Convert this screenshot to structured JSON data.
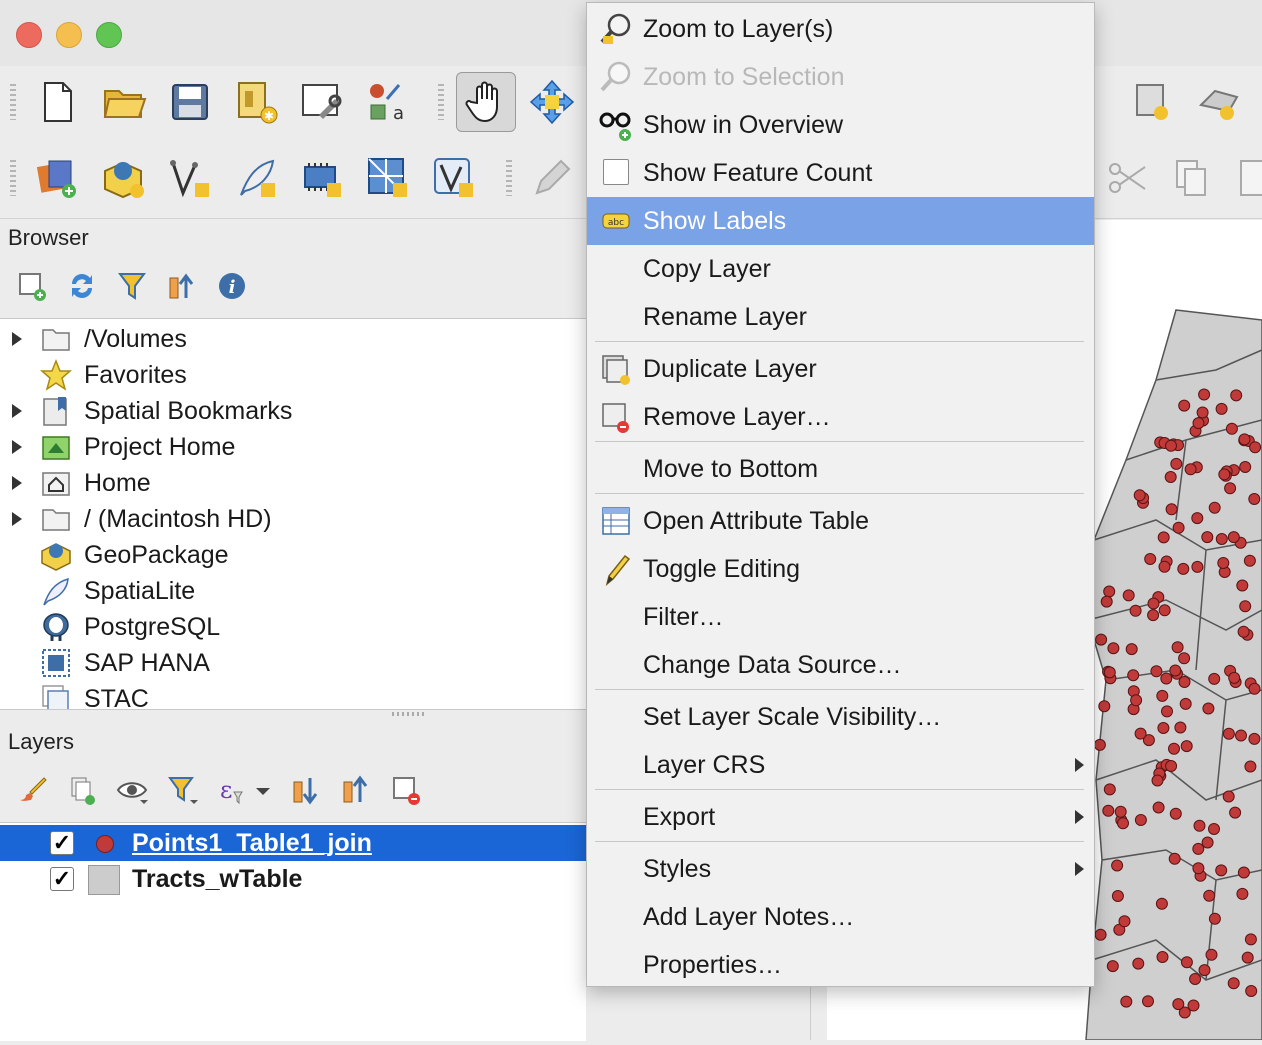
{
  "window": {
    "close_color": "#ed6a5e",
    "minimize_color": "#f5bf4f",
    "zoom_color": "#61c554"
  },
  "browser": {
    "title": "Browser",
    "tools": [
      "add-layer-icon",
      "refresh-icon",
      "filter-icon",
      "collapse-all-icon",
      "info-icon"
    ],
    "items": [
      {
        "label": "/Volumes",
        "icon": "folder-icon",
        "expandable": true
      },
      {
        "label": "Favorites",
        "icon": "star-icon",
        "expandable": false
      },
      {
        "label": "Spatial Bookmarks",
        "icon": "bookmark-icon",
        "expandable": true
      },
      {
        "label": "Project Home",
        "icon": "project-home-icon",
        "expandable": true
      },
      {
        "label": "Home",
        "icon": "home-icon",
        "expandable": true
      },
      {
        "label": "/ (Macintosh HD)",
        "icon": "folder-icon",
        "expandable": true
      },
      {
        "label": "GeoPackage",
        "icon": "geopackage-icon",
        "expandable": false
      },
      {
        "label": "SpatiaLite",
        "icon": "spatialite-icon",
        "expandable": false
      },
      {
        "label": "PostgreSQL",
        "icon": "postgresql-icon",
        "expandable": false
      },
      {
        "label": "SAP HANA",
        "icon": "sap-hana-icon",
        "expandable": false
      },
      {
        "label": "STAC",
        "icon": "stac-icon",
        "expandable": false
      }
    ]
  },
  "layers": {
    "title": "Layers",
    "items": [
      {
        "label": "Points1_Table1_join",
        "checked": true,
        "selected": true,
        "symbol_color": "#c03a3a"
      },
      {
        "label": "Tracts_wTable",
        "checked": true,
        "selected": false,
        "symbol_color": "#cccccc"
      }
    ],
    "checkmark": "✓"
  },
  "context_menu": {
    "items": [
      {
        "label": "Zoom to Layer(s)",
        "mnemonic": "Z",
        "icon": "zoom-layer-icon",
        "enabled": true
      },
      {
        "label": "Zoom to Selection",
        "mnemonic": "S",
        "icon": "zoom-selection-icon",
        "enabled": false
      },
      {
        "label": "Show in Overview",
        "mnemonic": "O",
        "icon": "overview-glasses-icon",
        "enabled": true
      },
      {
        "label": "Show Feature Count",
        "mnemonic": "C",
        "icon": "checkbox-icon",
        "enabled": true
      },
      {
        "label": "Show Labels",
        "mnemonic": "L",
        "icon": "labels-abc-icon",
        "enabled": true,
        "highlighted": true
      },
      {
        "label": "Copy Layer",
        "enabled": true
      },
      {
        "label": "Rename Layer",
        "mnemonic": "n",
        "enabled": true
      },
      {
        "label": "Duplicate Layer",
        "mnemonic": "D",
        "icon": "duplicate-layer-icon",
        "enabled": true
      },
      {
        "label": "Remove Layer…",
        "mnemonic": "R",
        "icon": "remove-layer-icon",
        "enabled": true
      },
      {
        "label": "Move to Bottom",
        "mnemonic": "B",
        "enabled": true
      },
      {
        "label": "Open Attribute Table",
        "mnemonic": "A",
        "icon": "attribute-table-icon",
        "enabled": true
      },
      {
        "label": "Toggle Editing",
        "mnemonic": "E",
        "icon": "pencil-icon",
        "enabled": true
      },
      {
        "label": "Filter…",
        "mnemonic": "F",
        "enabled": true
      },
      {
        "label": "Change Data Source…",
        "mnemonic": "h",
        "enabled": true
      },
      {
        "label": "Set Layer Scale Visibility…",
        "mnemonic": "V",
        "enabled": true
      },
      {
        "label": "Layer CRS",
        "enabled": true,
        "submenu": true
      },
      {
        "label": "Export",
        "mnemonic": "x",
        "enabled": true,
        "submenu": true
      },
      {
        "label": "Styles",
        "enabled": true,
        "submenu": true
      },
      {
        "label": "Add Layer Notes…",
        "enabled": true
      },
      {
        "label": "Properties…",
        "mnemonic": "P",
        "enabled": true
      }
    ]
  },
  "colors": {
    "selection_blue": "#1a66d6",
    "menu_highlight": "#7aa2e6",
    "feature_point": "#c03a3a",
    "tract_fill": "#cfcfcf"
  }
}
